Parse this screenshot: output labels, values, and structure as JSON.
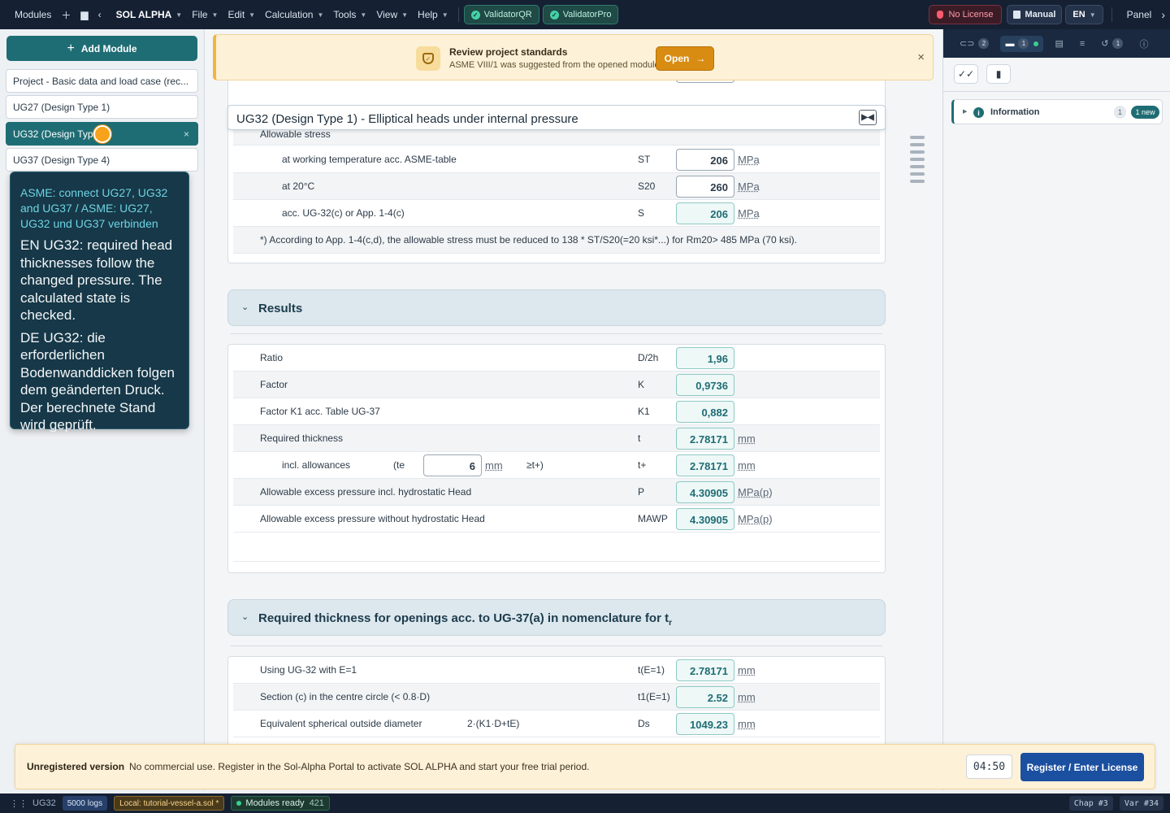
{
  "topbar": {
    "modules": "Modules",
    "app_name": "SOL ALPHA",
    "menus": [
      "File",
      "Edit",
      "Calculation",
      "Tools",
      "View",
      "Help"
    ],
    "validators": [
      "ValidatorQR",
      "ValidatorPro"
    ],
    "license": "No License",
    "manual": "Manual",
    "lang": "EN",
    "panel": "Panel"
  },
  "sidebar": {
    "add_module": "Add Module",
    "modules": [
      "Project - Basic data and load case (rec...",
      "UG27 (Design Type 1)",
      "UG32 (Design Type",
      "UG37 (Design Type 4)"
    ],
    "close": "×",
    "tooltip": {
      "title": "ASME: connect UG27, UG32 and UG37 / ASME: UG27, UG32 und UG37 verbinden",
      "en": "EN UG32: required head thicknesses follow the changed pressure. The calculated state is checked.",
      "de": "DE UG32: die erforderlichen Bodenwanddicken folgen dem geänderten Druck. Der berechnete Stand wird geprüft."
    }
  },
  "banner": {
    "title": "Review project standards",
    "subtitle": "ASME VIII/1 was suggested from the opened module.",
    "open": "Open",
    "close": "×"
  },
  "module_header": {
    "title": "UG32 (Design Type 1) - Elliptical heads under internal pressure",
    "collapse": "▶◀"
  },
  "stress": {
    "heading": "Allowable stress",
    "rows": [
      {
        "label": "at working temperature acc. ASME-table",
        "symbol": "ST",
        "value": "206",
        "unit": "MPa"
      },
      {
        "label": "at 20°C",
        "symbol": "S20",
        "value": "260",
        "unit": "MPa"
      },
      {
        "label": "acc. UG-32(c) or App. 1-4(c)",
        "symbol": "S",
        "value": "206",
        "unit": "MPa"
      }
    ],
    "note": "*)   According to App. 1-4(c,d), the allowable stress must be reduced to 138 * ST/S20(=20 ksi*...) for Rm20> 485 MPa (70 ksi)."
  },
  "results": {
    "title": "Results",
    "rows": [
      {
        "label": "Ratio",
        "symbol": "D/2h",
        "value": "1,96",
        "unit": ""
      },
      {
        "label": "Factor",
        "symbol": "K",
        "value": "0,9736",
        "unit": ""
      },
      {
        "label": "Factor K1 acc. Table UG-37",
        "symbol": "K1",
        "value": "0,882",
        "unit": ""
      },
      {
        "label": "Required thickness",
        "symbol": "t",
        "value": "2.78171",
        "unit": "mm"
      },
      {
        "label": "Allowable excess pressure incl. hydrostatic Head",
        "symbol": "P",
        "value": "4.30905",
        "unit": "MPa(p)"
      },
      {
        "label": "Allowable excess pressure without hydrostatic Head",
        "symbol": "MAWP",
        "value": "4.30905",
        "unit": "MPa(p)"
      }
    ],
    "allowances": {
      "label": "incl. allowances",
      "open": "(te",
      "input": "6",
      "input_unit": "mm",
      "close": "≥t+)",
      "symbol": "t+",
      "value": "2.78171",
      "unit": "mm"
    }
  },
  "openings": {
    "title": "Required thickness for openings acc. to UG-37(a) in nomenclature for t",
    "title_sub": "r",
    "rows": [
      {
        "label": "Using UG-32 with E=1",
        "extra": "",
        "symbol": "t(E=1)",
        "value": "2.78171",
        "unit": "mm"
      },
      {
        "label": "Section (c) in the centre circle (< 0.8·D)",
        "extra": "",
        "symbol": "t1(E=1)",
        "value": "2.52",
        "unit": "mm"
      },
      {
        "label": "Equivalent spherical outside diameter",
        "extra": "2·(K1·D+tE)",
        "symbol": "Ds",
        "value": "1049.23",
        "unit": "mm"
      }
    ]
  },
  "right_panel": {
    "tabs": [
      {
        "icon": "link-icon",
        "count": "2"
      },
      {
        "icon": "comment-icon",
        "count": "1"
      },
      {
        "icon": "report-icon",
        "count": ""
      },
      {
        "icon": "list-icon",
        "count": ""
      },
      {
        "icon": "history-icon",
        "count": "1"
      },
      {
        "icon": "help-icon",
        "count": ""
      }
    ],
    "info_label": "Information",
    "info_count": "1",
    "info_new": "1 new"
  },
  "footer": {
    "title": "Unregistered version",
    "text": "No commercial use. Register in the Sol-Alpha Portal to activate SOL ALPHA and start your free trial period.",
    "timer": "04:50",
    "register": "Register / Enter License"
  },
  "status": {
    "module": "UG32",
    "logs": "5000 logs",
    "file": "Local: tutorial-vessel-a.sol *",
    "ready": "Modules ready",
    "ready_count": "421",
    "chap": "Chap #3",
    "var": "Var #34"
  }
}
